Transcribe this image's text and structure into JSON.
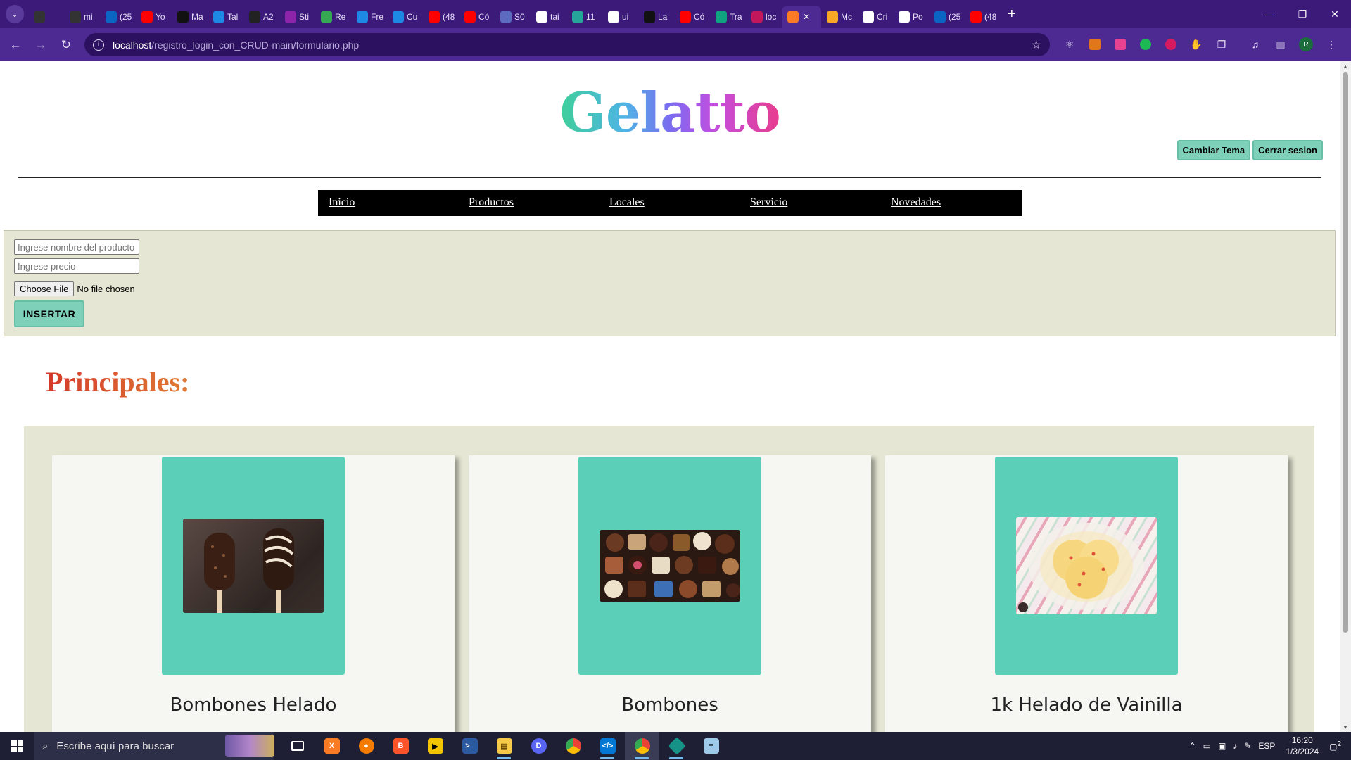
{
  "browser": {
    "tabs": [
      {
        "label": "",
        "icon": "github-icon",
        "color": "#333333"
      },
      {
        "label": "mi",
        "icon": "github-icon",
        "color": "#333333"
      },
      {
        "label": "(25",
        "icon": "linkedin-icon",
        "color": "#0a66c2"
      },
      {
        "label": "Yo",
        "icon": "youtube-icon",
        "color": "#ff0000"
      },
      {
        "label": "Ma",
        "icon": "circle-icon",
        "color": "#111111"
      },
      {
        "label": "Tal",
        "icon": "terminal-icon",
        "color": "#1e88e5"
      },
      {
        "label": "A2",
        "icon": "a2-icon",
        "color": "#222222"
      },
      {
        "label": "Sti",
        "icon": "sti-icon",
        "color": "#8e24aa"
      },
      {
        "label": "Re",
        "icon": "drive-icon",
        "color": "#34a853"
      },
      {
        "label": "Fre",
        "icon": "heart-icon",
        "color": "#1e88e5"
      },
      {
        "label": "Cu",
        "icon": "vscode-icon",
        "color": "#1e88e5"
      },
      {
        "label": "(48",
        "icon": "youtube-icon",
        "color": "#ff0000"
      },
      {
        "label": "Có",
        "icon": "youtube-icon",
        "color": "#ff0000"
      },
      {
        "label": "S0",
        "icon": "s0-icon",
        "color": "#5c6bc0"
      },
      {
        "label": "tai",
        "icon": "google-icon",
        "color": "#ffffff"
      },
      {
        "label": "11",
        "icon": "leaf-icon",
        "color": "#26a69a"
      },
      {
        "label": "ui",
        "icon": "google-icon",
        "color": "#ffffff"
      },
      {
        "label": "La",
        "icon": "la-icon",
        "color": "#111111"
      },
      {
        "label": "Có",
        "icon": "youtube-icon",
        "color": "#ff0000"
      },
      {
        "label": "Tra",
        "icon": "chatgpt-icon",
        "color": "#10a37f"
      },
      {
        "label": "loc",
        "icon": "mountain-icon",
        "color": "#c2185b"
      },
      {
        "label": "",
        "icon": "xampp-icon",
        "color": "#fb7a24",
        "active": true
      },
      {
        "label": "Mc",
        "icon": "m-icon",
        "color": "#f9a825"
      },
      {
        "label": "Cri",
        "icon": "cri-icon",
        "color": "#ffffff"
      },
      {
        "label": "Po",
        "icon": "code-icon",
        "color": "#ffffff"
      },
      {
        "label": "(25",
        "icon": "linkedin-icon",
        "color": "#0a66c2"
      },
      {
        "label": "(48",
        "icon": "youtube-icon",
        "color": "#ff0000"
      }
    ],
    "url_host": "localhost",
    "url_path": "/registro_login_con_CRUD-main/formulario.php",
    "profile_initial": "R"
  },
  "header": {
    "title": "Gelatto",
    "theme_button": "Cambiar Tema",
    "logout_button": "Cerrar sesion"
  },
  "nav": {
    "items": [
      "Inicio",
      "Productos",
      "Locales",
      "Servicio",
      "Novedades"
    ]
  },
  "form": {
    "name_placeholder": "Ingrese nombre del producto",
    "price_placeholder": "Ingrese precio",
    "file_button": "Choose File",
    "file_status": "No file chosen",
    "submit_label": "INSERTAR"
  },
  "section": {
    "title": "Principales:"
  },
  "products": [
    {
      "name": "Bombones Helado"
    },
    {
      "name": "Bombones"
    },
    {
      "name": "1k Helado de Vainilla"
    }
  ],
  "taskbar": {
    "search_placeholder": "Escribe aquí para buscar",
    "language": "ESP",
    "time": "16:20",
    "date": "1/3/2024",
    "notification_count": "2"
  },
  "colors": {
    "accent_button": "#7fd0b8",
    "card_image_bg": "#5ccfb9",
    "form_bg": "#e6e6d4",
    "browser_frame": "#4c2a92"
  }
}
